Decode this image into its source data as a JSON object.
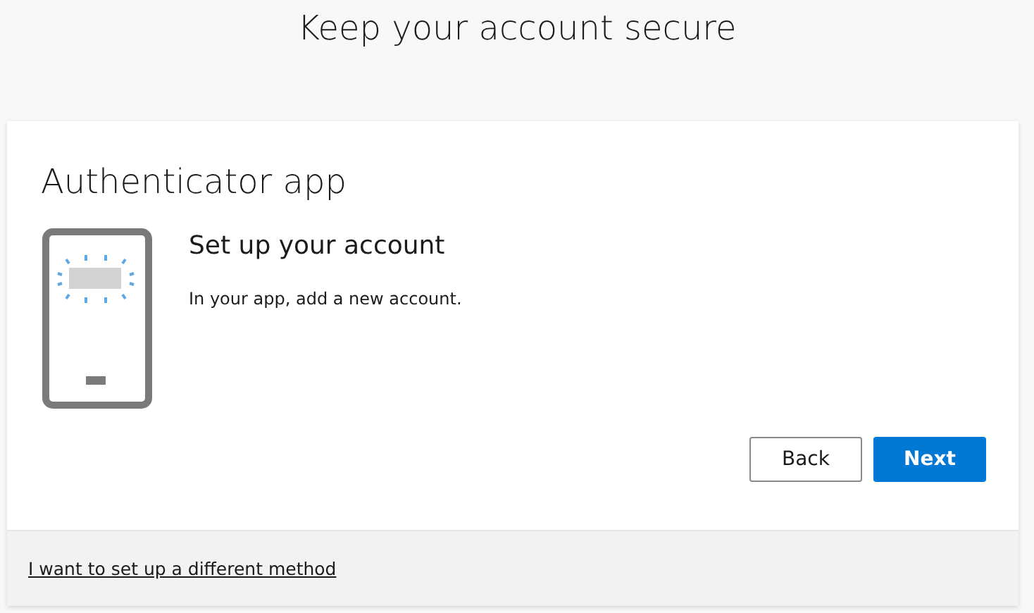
{
  "page_title": "Keep your account secure",
  "card": {
    "title": "Authenticator app",
    "heading": "Set up your account",
    "description": "In your app, add a new account.",
    "buttons": [
      {
        "label": "Back",
        "kind": "secondary"
      },
      {
        "label": "Next",
        "kind": "primary"
      }
    ],
    "footer_link": "I want to set up a different method"
  }
}
